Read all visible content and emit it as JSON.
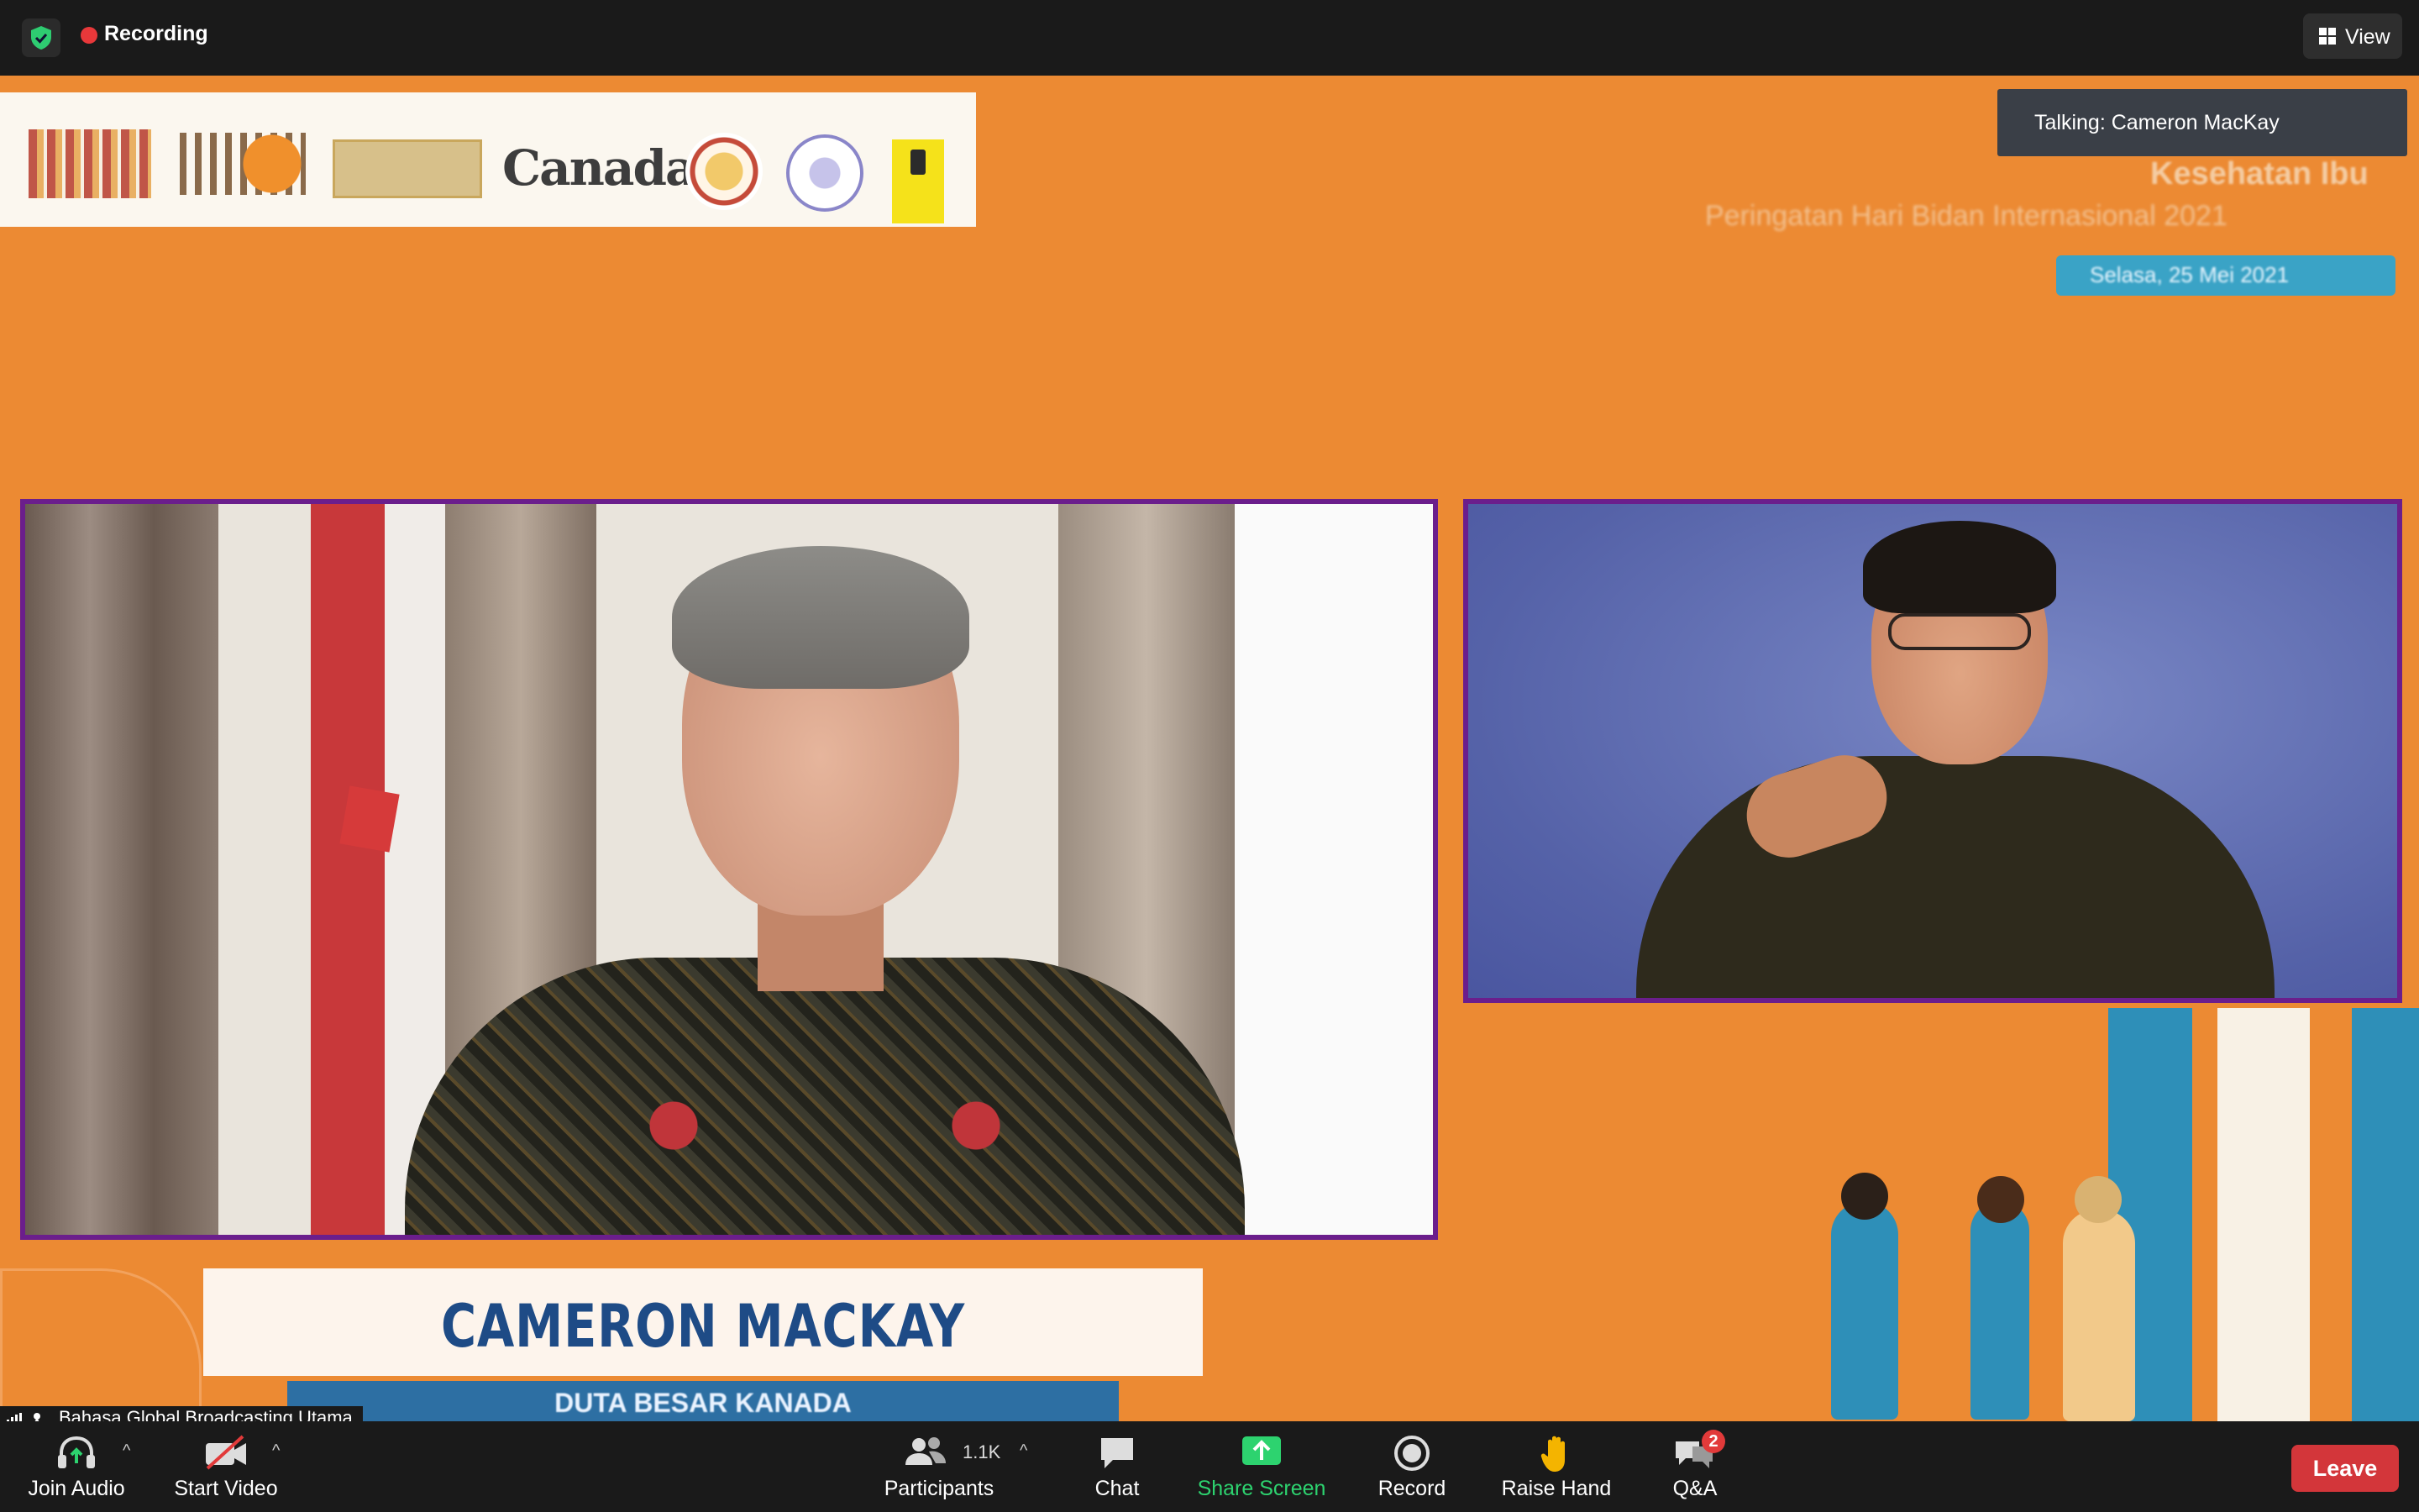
{
  "top_bar": {
    "recording_label": "Recording",
    "view_label": "View",
    "icons": [
      "shield-check-icon",
      "recording-dot-icon",
      "grid-view-icon"
    ]
  },
  "stage": {
    "talking_indicator": "Talking: Cameron MacKay",
    "slide_title": "Kesehatan Ibu",
    "slide_subtitle": "Peringatan Hari Bidan Internasional 2021",
    "slide_date": "Selasa, 25 Mei 2021",
    "logo_text": "Canada",
    "speaker_name": "CAMERON MACKAY",
    "speaker_title": "DUTA BESAR KANADA",
    "audio_source": "Bahasa Global Broadcasting Utama"
  },
  "toolbar": {
    "join_audio_label": "Join Audio",
    "start_video_label": "Start Video",
    "participants_label": "Participants",
    "participants_count": "1.1K",
    "chat_label": "Chat",
    "share_screen_label": "Share Screen",
    "record_label": "Record",
    "raise_hand_label": "Raise Hand",
    "qa_label": "Q&A",
    "qa_badge": "2",
    "leave_label": "Leave"
  },
  "colors": {
    "stage_background": "#ec8a33",
    "video_border": "#6b1e8c",
    "share_screen_green": "#2dd36f",
    "leave_red": "#d3363a",
    "recording_red": "#e8383a"
  }
}
